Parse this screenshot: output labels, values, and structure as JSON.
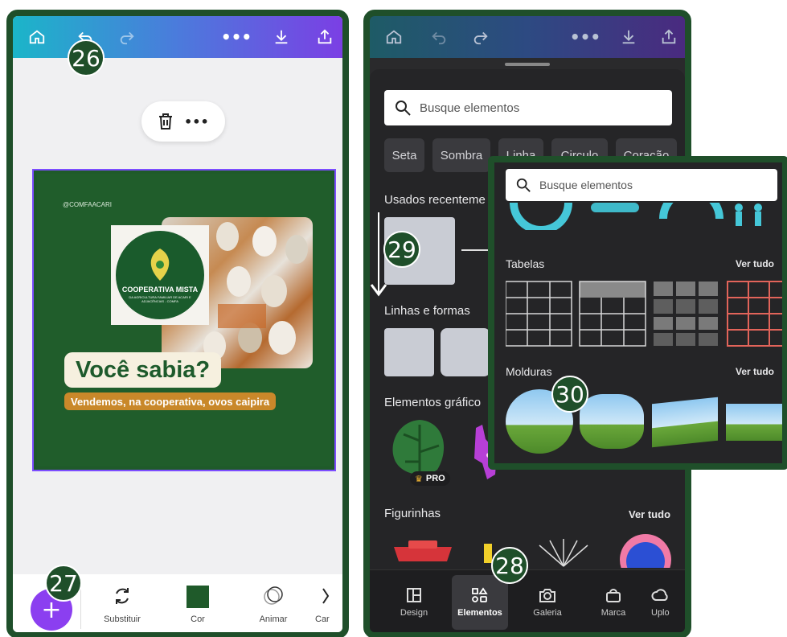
{
  "badges": {
    "b26": "26",
    "b27": "27",
    "b28": "28",
    "b29": "29",
    "b30": "30"
  },
  "left": {
    "design": {
      "handle": "@COMFAACARI",
      "logo_title": "COOPERATIVA MISTA",
      "logo_sub": "DA AGRICULTURA FAMILIAR DE ACARI E ADJACÊNCIAS - COMFA",
      "headline": "Você sabia?",
      "subline": "Vendemos, na cooperativa, ovos caipira"
    },
    "toolbar": {
      "tools": [
        {
          "label": "Substituir"
        },
        {
          "label": "Cor"
        },
        {
          "label": "Animar"
        },
        {
          "label": "Car"
        }
      ]
    }
  },
  "right": {
    "search_placeholder": "Busque elementos",
    "chips": [
      "Seta",
      "Sombra",
      "Linha",
      "Circulo",
      "Coração"
    ],
    "sections": {
      "recent": "Usados recenteme",
      "lines": "Linhas e formas",
      "graphics": "Elementos gráfico",
      "stickers": "Figurinhas",
      "see_all": "Ver tudo",
      "pro": "PRO"
    },
    "nav": [
      {
        "label": "Design"
      },
      {
        "label": "Elementos"
      },
      {
        "label": "Galeria"
      },
      {
        "label": "Marca"
      },
      {
        "label": "Uplo"
      }
    ]
  },
  "overlay": {
    "search_placeholder": "Busque elementos",
    "tables_title": "Tabelas",
    "frames_title": "Molduras",
    "see_all": "Ver tudo"
  },
  "colors": {
    "brand_green": "#1f4f2a",
    "accent_purple": "#8b3ff0",
    "selection": "#7c4dff"
  }
}
